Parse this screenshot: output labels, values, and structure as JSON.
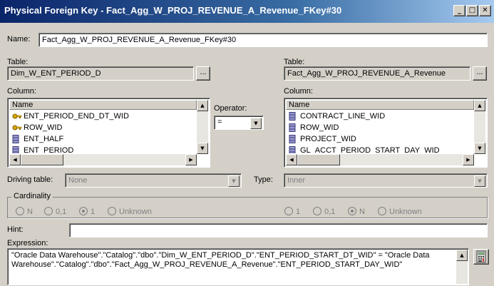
{
  "window": {
    "title": "Physical Foreign Key - Fact_Agg_W_PROJ_REVENUE_A_Revenue_FKey#30",
    "minimize_glyph": "_",
    "maximize_glyph": "□",
    "close_glyph": "✕"
  },
  "name": {
    "label": "Name:",
    "value": "Fact_Agg_W_PROJ_REVENUE_A_Revenue_FKey#30"
  },
  "left": {
    "table_label": "Table:",
    "table_value": "Dim_W_ENT_PERIOD_D",
    "browse_label": "...",
    "column_label": "Column:",
    "column_header": "Name",
    "columns": [
      {
        "name": "ENT_PERIOD_END_DT_WID",
        "icon": "key-icon"
      },
      {
        "name": "ROW_WID",
        "icon": "key-icon"
      },
      {
        "name": "ENT_HALF",
        "icon": "column-icon"
      },
      {
        "name": "ENT_PERIOD",
        "icon": "column-icon"
      }
    ]
  },
  "operator": {
    "label": "Operator:",
    "value": "="
  },
  "right": {
    "table_label": "Table:",
    "table_value": "Fact_Agg_W_PROJ_REVENUE_A_Revenue",
    "browse_label": "...",
    "column_label": "Column:",
    "column_header": "Name",
    "columns": [
      {
        "name": "CONTRACT_LINE_WID",
        "icon": "column-icon"
      },
      {
        "name": "ROW_WID",
        "icon": "column-icon"
      },
      {
        "name": "PROJECT_WID",
        "icon": "column-icon"
      },
      {
        "name": "GL_ACCT_PERIOD_START_DAY_WID",
        "icon": "column-icon"
      }
    ]
  },
  "driving_table": {
    "label": "Driving table:",
    "value": "None"
  },
  "type": {
    "label": "Type:",
    "value": "Inner"
  },
  "cardinality": {
    "label": "Cardinality",
    "left_options": [
      {
        "label": "N",
        "selected": false
      },
      {
        "label": "0,1",
        "selected": false
      },
      {
        "label": "1",
        "selected": true
      },
      {
        "label": "Unknown",
        "selected": false
      }
    ],
    "right_options": [
      {
        "label": "1",
        "selected": false
      },
      {
        "label": "0,1",
        "selected": false
      },
      {
        "label": "N",
        "selected": true
      },
      {
        "label": "Unknown",
        "selected": false
      }
    ]
  },
  "hint": {
    "label": "Hint:",
    "value": ""
  },
  "expression": {
    "label": "Expression:",
    "value": "\"Oracle Data Warehouse\".\"Catalog\".\"dbo\".\"Dim_W_ENT_PERIOD_D\".\"ENT_PERIOD_START_DT_WID\" = \"Oracle Data Warehouse\".\"Catalog\".\"dbo\".\"Fact_Agg_W_PROJ_REVENUE_A_Revenue\".\"ENT_PERIOD_START_DAY_WID\""
  },
  "colors": {
    "titlebar_start": "#0a246a",
    "titlebar_end": "#a6caf0",
    "dialog_bg": "#d4d0c8",
    "key_icon": "#d8a800",
    "column_icon": "#5a5a9a"
  }
}
